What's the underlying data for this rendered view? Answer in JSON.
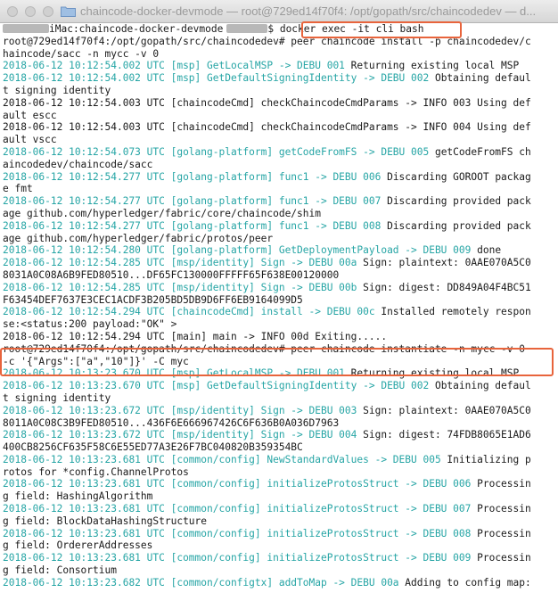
{
  "window": {
    "title": "chaincode-docker-devmode — root@729ed14f70f4: /opt/gopath/src/chaincodedev — d..."
  },
  "colors": {
    "accent_box": "#e8643c",
    "log_cyan": "#26a5a5",
    "text": "#1a1a1a"
  },
  "terminal": {
    "prompt1_host": "iMac:chaincode-docker-devmode",
    "prompt1_sym": "$",
    "cmd_docker": "docker exec -it cli bash",
    "lines": [
      {
        "t": "root@729ed14f70f4:/opt/gopath/src/chaincodedev# peer chaincode install -p chaincodedev/c"
      },
      {
        "t": "haincode/sacc -n mycc -v 0"
      },
      {
        "c": "2018-06-12 10:12:54.002 UTC [msp] GetLocalMSP -> DEBU 001",
        "t": " Returning existing local MSP"
      },
      {
        "c": "2018-06-12 10:12:54.002 UTC [msp] GetDefaultSigningIdentity -> DEBU 002",
        "t": " Obtaining defaul"
      },
      {
        "t": "t signing identity"
      },
      {
        "t": "2018-06-12 10:12:54.003 UTC [chaincodeCmd] checkChaincodeCmdParams -> INFO 003 Using def"
      },
      {
        "t": "ault escc"
      },
      {
        "t": "2018-06-12 10:12:54.003 UTC [chaincodeCmd] checkChaincodeCmdParams -> INFO 004 Using def"
      },
      {
        "t": "ault vscc"
      },
      {
        "c": "2018-06-12 10:12:54.073 UTC [golang-platform] getCodeFromFS -> DEBU 005",
        "t": " getCodeFromFS ch"
      },
      {
        "t": "aincodedev/chaincode/sacc"
      },
      {
        "c": "2018-06-12 10:12:54.277 UTC [golang-platform] func1 -> DEBU 006",
        "t": " Discarding GOROOT packag"
      },
      {
        "t": "e fmt"
      },
      {
        "c": "2018-06-12 10:12:54.277 UTC [golang-platform] func1 -> DEBU 007",
        "t": " Discarding provided pack"
      },
      {
        "t": "age github.com/hyperledger/fabric/core/chaincode/shim"
      },
      {
        "c": "2018-06-12 10:12:54.277 UTC [golang-platform] func1 -> DEBU 008",
        "t": " Discarding provided pack"
      },
      {
        "t": "age github.com/hyperledger/fabric/protos/peer"
      },
      {
        "c": "2018-06-12 10:12:54.280 UTC [golang-platform] GetDeploymentPayload -> DEBU 009",
        "t": " done"
      },
      {
        "c": "2018-06-12 10:12:54.285 UTC [msp/identity] Sign -> DEBU 00a",
        "t": " Sign: plaintext: 0AAE070A5C0"
      },
      {
        "t": "8031A0C08A6B9FED80510...DF65FC130000FFFFF65F638E00120000"
      },
      {
        "c": "2018-06-12 10:12:54.285 UTC [msp/identity] Sign -> DEBU 00b",
        "t": " Sign: digest: DD849A04F4BC51"
      },
      {
        "t": "F63454DEF7637E3CEC1ACDF3B205BD5DB9D6FF6EB9164099D5"
      },
      {
        "c": "2018-06-12 10:12:54.294 UTC [chaincodeCmd] install -> DEBU 00c",
        "t": " Installed remotely respon"
      },
      {
        "t": "se:<status:200 payload:\"OK\" >"
      },
      {
        "t": "2018-06-12 10:12:54.294 UTC [main] main -> INFO 00d Exiting....."
      },
      {
        "t": "root@729ed14f70f4:/opt/gopath/src/chaincodedev# peer chaincode instantiate -n mycc -v 0"
      },
      {
        "t": "-c '{\"Args\":[\"a\",\"10\"]}' -C myc"
      },
      {
        "c": "2018-06-12 10:13:23.670 UTC [msp] GetLocalMSP -> DEBU 001",
        "t": " Returning existing local MSP"
      },
      {
        "c": "2018-06-12 10:13:23.670 UTC [msp] GetDefaultSigningIdentity -> DEBU 002",
        "t": " Obtaining defaul"
      },
      {
        "t": "t signing identity"
      },
      {
        "c": "2018-06-12 10:13:23.672 UTC [msp/identity] Sign -> DEBU 003",
        "t": " Sign: plaintext: 0AAE070A5C0"
      },
      {
        "t": "8011A0C08C3B9FED80510...436F6E666967426C6F636B0A036D7963"
      },
      {
        "c": "2018-06-12 10:13:23.672 UTC [msp/identity] Sign -> DEBU 004",
        "t": " Sign: digest: 74FDB8065E1AD6"
      },
      {
        "t": "400CB8256CF635F58C6E55ED77A3E26F7BC040820B359354BC"
      },
      {
        "c": "2018-06-12 10:13:23.681 UTC [common/config] NewStandardValues -> DEBU 005",
        "t": " Initializing p"
      },
      {
        "t": "rotos for *config.ChannelProtos"
      },
      {
        "c": "2018-06-12 10:13:23.681 UTC [common/config] initializeProtosStruct -> DEBU 006",
        "t": " Processin"
      },
      {
        "t": "g field: HashingAlgorithm"
      },
      {
        "c": "2018-06-12 10:13:23.681 UTC [common/config] initializeProtosStruct -> DEBU 007",
        "t": " Processin"
      },
      {
        "t": "g field: BlockDataHashingStructure"
      },
      {
        "c": "2018-06-12 10:13:23.681 UTC [common/config] initializeProtosStruct -> DEBU 008",
        "t": " Processin"
      },
      {
        "t": "g field: OrdererAddresses"
      },
      {
        "c": "2018-06-12 10:13:23.681 UTC [common/config] initializeProtosStruct -> DEBU 009",
        "t": " Processin"
      },
      {
        "t": "g field: Consortium"
      },
      {
        "c": "2018-06-12 10:13:23.682 UTC [common/configtx] addToMap -> DEBU 00a",
        "t": " Adding to config map:"
      }
    ]
  }
}
